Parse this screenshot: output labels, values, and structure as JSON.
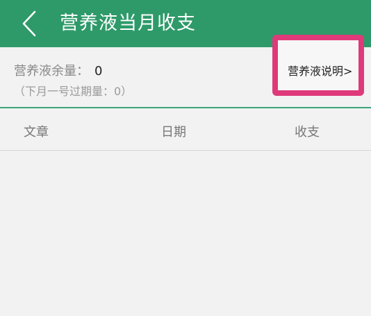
{
  "header": {
    "title": "营养液当月收支",
    "back_icon": "chevron-left-icon"
  },
  "summary": {
    "balance_label": "营养液余量：",
    "balance_value": "0",
    "expire_note": "（下月一号过期量：0）",
    "explain_link": "营养液说明>"
  },
  "table": {
    "columns": [
      "文章",
      "日期",
      "收支"
    ],
    "rows": []
  },
  "colors": {
    "header_bg": "#2e9a69",
    "accent_line": "#3aa57a",
    "highlight_border": "#de3a7a",
    "background": "#f2f2f2"
  }
}
